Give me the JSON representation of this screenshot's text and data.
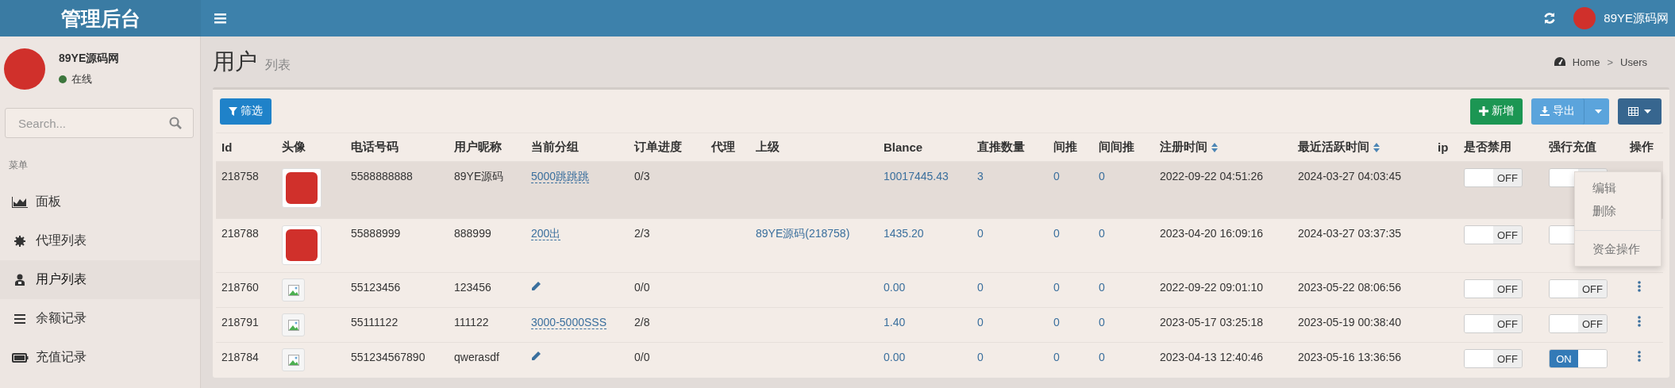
{
  "header": {
    "title": "管理后台",
    "user_name": "89YE源码网"
  },
  "sidebar": {
    "user": {
      "name": "89YE源码网",
      "status": "在线"
    },
    "search": {
      "placeholder": "Search..."
    },
    "menu_header": "菜单",
    "items": [
      {
        "label": "面板",
        "selected": false
      },
      {
        "label": "代理列表",
        "selected": false
      },
      {
        "label": "用户列表",
        "selected": true
      },
      {
        "label": "余额记录",
        "selected": false
      },
      {
        "label": "充值记录",
        "selected": false
      }
    ]
  },
  "page": {
    "title": "用户",
    "subtitle": "列表",
    "breadcrumb": {
      "items": [
        "Home",
        "Users"
      ],
      "separator": ">"
    }
  },
  "toolbar": {
    "filter_button": "筛选",
    "add_button": "新增",
    "export_button": "导出"
  },
  "table": {
    "columns": [
      {
        "label": "Id",
        "sortable": false
      },
      {
        "label": "头像",
        "sortable": false
      },
      {
        "label": "电话号码",
        "sortable": false
      },
      {
        "label": "用户昵称",
        "sortable": false
      },
      {
        "label": "当前分组",
        "sortable": false
      },
      {
        "label": "订单进度",
        "sortable": false
      },
      {
        "label": "代理",
        "sortable": false
      },
      {
        "label": "上级",
        "sortable": false
      },
      {
        "label": "Blance",
        "sortable": false
      },
      {
        "label": "直推数量",
        "sortable": false
      },
      {
        "label": "间推",
        "sortable": false
      },
      {
        "label": "间间推",
        "sortable": false
      },
      {
        "label": "注册时间",
        "sortable": true
      },
      {
        "label": "最近活跃时间",
        "sortable": true
      },
      {
        "label": "ip",
        "sortable": false
      },
      {
        "label": "是否禁用",
        "sortable": false
      },
      {
        "label": "强行充值",
        "sortable": false
      },
      {
        "label": "操作",
        "sortable": false
      }
    ],
    "rows": [
      {
        "id": "218758",
        "avatar": {
          "kind": "logo"
        },
        "phone": "5588888888",
        "nickname": "89YE源码",
        "group": {
          "kind": "link",
          "text": "5000跳跳跳"
        },
        "orders": "0/3",
        "balance": "10017445.43",
        "direct": "3",
        "indirect": "0",
        "indirect2": "0",
        "registered": "2022-09-22 04:51:26",
        "last_active": "2024-03-27 04:03:45",
        "disabled": {
          "on": false,
          "label": "OFF"
        },
        "force_recharge": {
          "on": false
        },
        "highlighted": true,
        "menu_open": true
      },
      {
        "id": "218788",
        "avatar": {
          "kind": "logo"
        },
        "phone": "55888999",
        "nickname": "888999",
        "group": {
          "kind": "link",
          "text": "200出"
        },
        "orders": "2/3",
        "parent": "89YE源码(218758)",
        "balance": "1435.20",
        "direct": "0",
        "indirect": "0",
        "indirect2": "0",
        "registered": "2023-04-20 16:09:16",
        "last_active": "2024-03-27 03:37:35",
        "disabled": {
          "on": false,
          "label": "OFF"
        },
        "force_recharge": {
          "on": false
        },
        "highlighted": false,
        "menu_open": false
      },
      {
        "id": "218760",
        "avatar": {
          "kind": "broken"
        },
        "phone": "55123456",
        "nickname": "123456",
        "group": {
          "kind": "edit"
        },
        "orders": "0/0",
        "balance": "0.00",
        "direct": "0",
        "indirect": "0",
        "indirect2": "0",
        "registered": "2022-09-22 09:01:10",
        "last_active": "2023-05-22 08:06:56",
        "disabled": {
          "on": false,
          "label": "OFF"
        },
        "force_recharge": {
          "on": false,
          "label": "OFF"
        },
        "highlighted": false,
        "menu_open": false
      },
      {
        "id": "218791",
        "avatar": {
          "kind": "broken"
        },
        "phone": "55111122",
        "nickname": "111122",
        "group": {
          "kind": "link",
          "text": "3000-5000SSS"
        },
        "orders": "2/8",
        "balance": "1.40",
        "direct": "0",
        "indirect": "0",
        "indirect2": "0",
        "registered": "2023-05-17 03:25:18",
        "last_active": "2023-05-19 00:38:40",
        "disabled": {
          "on": false,
          "label": "OFF"
        },
        "force_recharge": {
          "on": false,
          "label": "OFF"
        },
        "highlighted": false,
        "menu_open": false
      },
      {
        "id": "218784",
        "avatar": {
          "kind": "broken"
        },
        "phone": "551234567890",
        "nickname": "qwerasdf",
        "group": {
          "kind": "edit"
        },
        "orders": "0/0",
        "balance": "0.00",
        "direct": "0",
        "indirect": "0",
        "indirect2": "0",
        "registered": "2023-04-13 12:40:46",
        "last_active": "2023-05-16 13:36:56",
        "disabled": {
          "on": false,
          "label": "OFF"
        },
        "force_recharge": {
          "on": true,
          "label": "ON"
        },
        "highlighted": false,
        "menu_open": false
      }
    ]
  },
  "action_menu": {
    "groups": [
      [
        "编辑",
        "删除"
      ],
      [
        "资金操作"
      ]
    ]
  }
}
